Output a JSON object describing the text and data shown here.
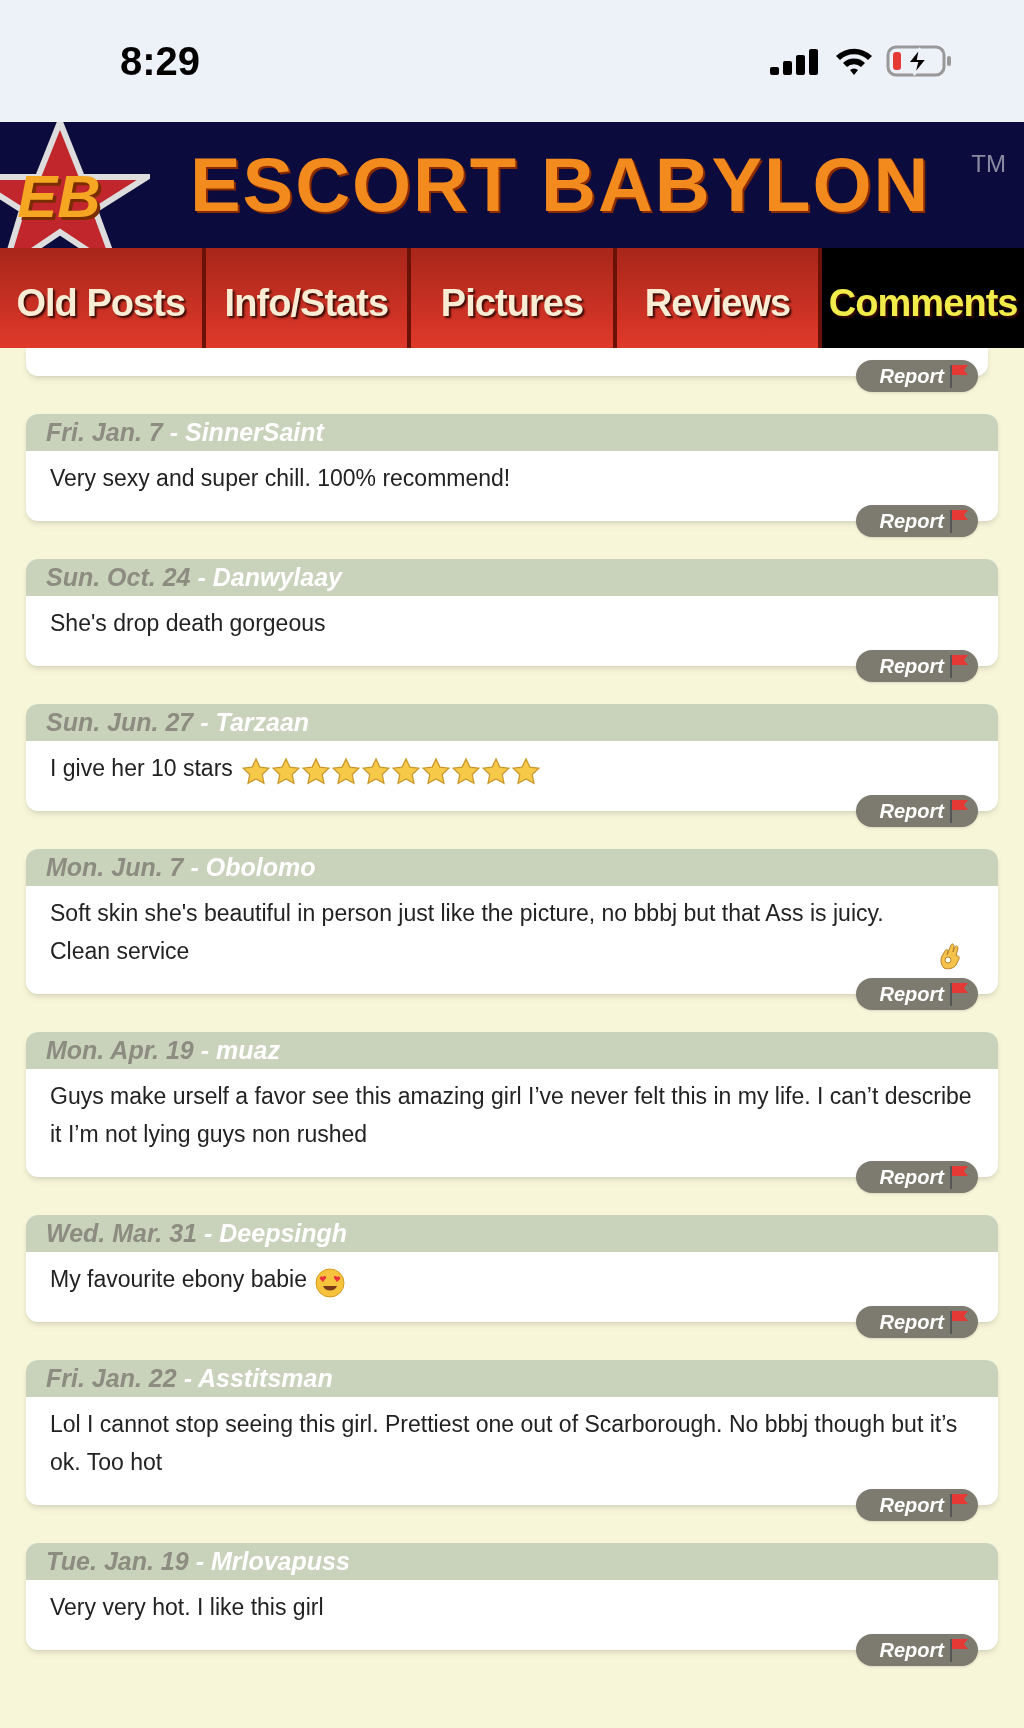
{
  "status_bar": {
    "time": "8:29"
  },
  "header": {
    "badge": "EB",
    "title": "ESCORT BABYLON",
    "trademark": "TM"
  },
  "tabs": [
    {
      "label": "Old Posts",
      "selected": false
    },
    {
      "label": "Info/Stats",
      "selected": false
    },
    {
      "label": "Pictures",
      "selected": false
    },
    {
      "label": "Reviews",
      "selected": false
    },
    {
      "label": "Comments",
      "selected": true
    }
  ],
  "comments": [
    {
      "kind": "partial",
      "report": "Report"
    },
    {
      "kind": "text",
      "date": "Fri. Jan. 7",
      "author": "- SinnerSaint",
      "text": "Very sexy and super chill. 100% recommend!",
      "report": "Report"
    },
    {
      "kind": "text",
      "date": "Sun. Oct. 24",
      "author": "- Danwylaay",
      "text": "She's drop death gorgeous",
      "report": "Report"
    },
    {
      "kind": "stars",
      "date": "Sun. Jun. 27",
      "author": "- Tarzaan",
      "text": "I give her 10 stars",
      "stars": 10,
      "report": "Report"
    },
    {
      "kind": "ok-hand",
      "date": "Mon. Jun. 7",
      "author": "- Obolomo",
      "text": "Soft skin she's beautiful in person just like the picture, no bbbj but that Ass is juicy. Clean service",
      "report": "Report"
    },
    {
      "kind": "text",
      "date": "Mon. Apr. 19",
      "author": "- muaz",
      "text": "Guys make urself a favor see this amazing girl I’ve never felt this in my life. I can’t describe it I’m not lying guys non rushed",
      "report": "Report"
    },
    {
      "kind": "heart-eyes",
      "date": "Wed. Mar. 31",
      "author": "- Deepsingh",
      "text": "My favourite ebony babie",
      "report": "Report"
    },
    {
      "kind": "text",
      "date": "Fri. Jan. 22",
      "author": "- Asstitsman",
      "text": "Lol I cannot stop seeing this girl. Prettiest one out of Scarborough. No bbbj though but it’s ok. Too hot",
      "report": "Report"
    },
    {
      "kind": "text",
      "date": "Tue. Jan. 19",
      "author": "- Mrlovapuss",
      "text": "Very very hot. I like this girl",
      "report": "Report"
    }
  ]
}
